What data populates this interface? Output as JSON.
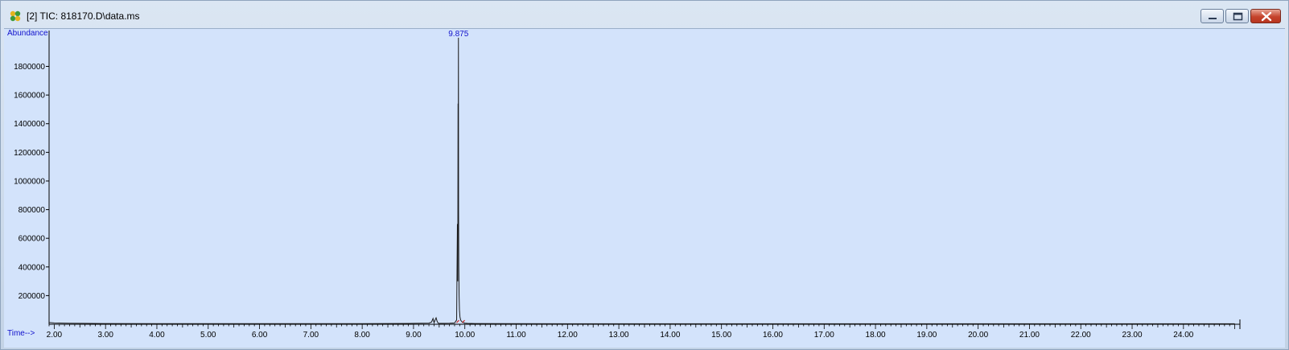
{
  "window": {
    "title": "[2] TIC: 818170.D\\data.ms"
  },
  "colors": {
    "plot_background": "#d3e3fb",
    "trace": "#1a1a1a",
    "label_blue": "#1111cc",
    "axis": "#000000",
    "baseline_marker": "#cc2222"
  },
  "icons": {
    "app": "chromatogram-app-icon",
    "minimize": "minimize-icon",
    "maximize": "maximize-icon",
    "close": "close-icon"
  },
  "chart_data": {
    "type": "line",
    "title": "",
    "ylabel": "Abundance",
    "xlabel": "Time-->",
    "xlim": [
      1.9,
      25.1
    ],
    "ylim": [
      0,
      2050000
    ],
    "x_ticks": [
      2.0,
      3.0,
      4.0,
      5.0,
      6.0,
      7.0,
      8.0,
      9.0,
      10.0,
      11.0,
      12.0,
      13.0,
      14.0,
      15.0,
      16.0,
      17.0,
      18.0,
      19.0,
      20.0,
      21.0,
      22.0,
      23.0,
      24.0
    ],
    "x_tick_labels": [
      "2.00",
      "3.00",
      "4.00",
      "5.00",
      "6.00",
      "7.00",
      "8.00",
      "9.00",
      "10.00",
      "11.00",
      "12.00",
      "13.00",
      "14.00",
      "15.00",
      "16.00",
      "17.00",
      "18.00",
      "19.00",
      "20.00",
      "21.00",
      "22.00",
      "23.00",
      "24.00"
    ],
    "y_ticks": [
      200000,
      400000,
      600000,
      800000,
      1000000,
      1200000,
      1400000,
      1600000,
      1800000
    ],
    "y_tick_labels": [
      "200000",
      "400000",
      "600000",
      "800000",
      "1000000",
      "1200000",
      "1400000",
      "1600000",
      "1800000"
    ],
    "peak_labels": [
      {
        "x": 9.875,
        "y": 2000000,
        "text": "9.875"
      }
    ],
    "series": [
      {
        "x": [
          1.9,
          2.0,
          2.3,
          2.6,
          3.0,
          4.0,
          5.0,
          6.0,
          7.0,
          8.0,
          8.5,
          9.0,
          9.3,
          9.35,
          9.38,
          9.4,
          9.42,
          9.44,
          9.46,
          9.48,
          9.5,
          9.6,
          9.7,
          9.8,
          9.84,
          9.855,
          9.862,
          9.868,
          9.872,
          9.875,
          9.878,
          9.882,
          9.888,
          9.895,
          9.905,
          9.92,
          9.95,
          10.0,
          10.05,
          10.2,
          11.0,
          12.0,
          13.0,
          14.0,
          15.0,
          16.0,
          17.0,
          18.0,
          19.0,
          20.0,
          21.0,
          22.0,
          23.0,
          24.0,
          25.0
        ],
        "y": [
          12000,
          9000,
          7000,
          6000,
          5000,
          4500,
          4000,
          4000,
          4000,
          4500,
          5000,
          6000,
          8000,
          15000,
          40000,
          10000,
          30000,
          45000,
          20000,
          8000,
          6000,
          6000,
          7000,
          9000,
          30000,
          700000,
          300000,
          1540000,
          1200000,
          2000000,
          800000,
          400000,
          200000,
          100000,
          50000,
          28000,
          14000,
          8000,
          6000,
          5000,
          4000,
          3500,
          3500,
          3500,
          3500,
          3500,
          3500,
          3500,
          3500,
          3500,
          3500,
          3500,
          3500,
          3500,
          3500
        ]
      }
    ]
  }
}
